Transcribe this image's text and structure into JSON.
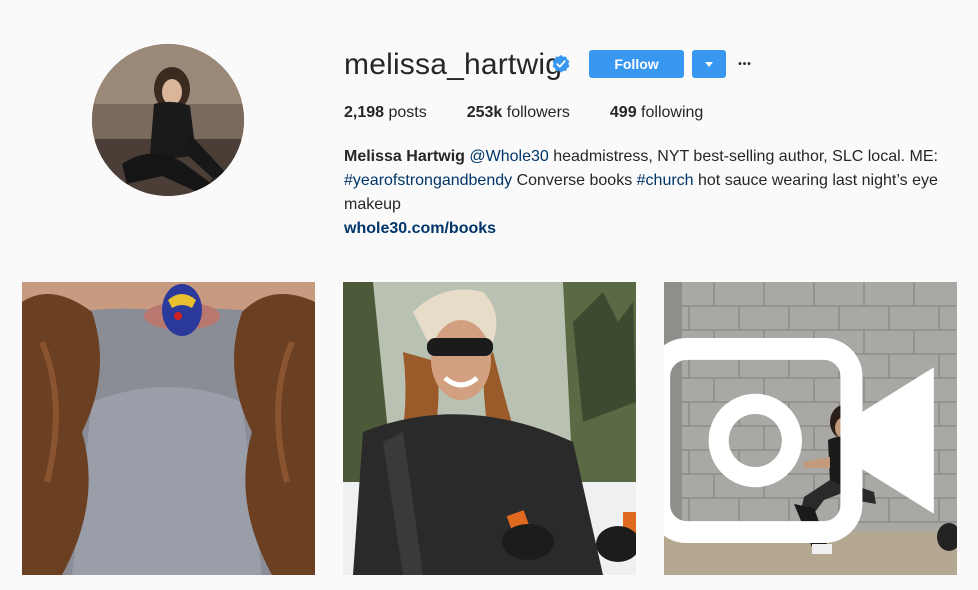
{
  "profile": {
    "username": "melissa_hartwig",
    "verified": true,
    "follow_label": "Follow",
    "more_label": "•••",
    "stats": {
      "posts_count": "2,198",
      "posts_label": " posts",
      "followers_count": "253k",
      "followers_label": " followers",
      "following_count": "499",
      "following_label": " following"
    },
    "bio": {
      "name": "Melissa Hartwig",
      "mention": "@Whole30",
      "text1": " headmistress, NYT best-selling author, SLC local. ME: ",
      "hashtag1": "#yearofstrongandbendy",
      "text2": " Converse books ",
      "hashtag2": "#church",
      "text3": " hot sauce wearing last night’s eye makeup",
      "website": "whole30.com/books"
    }
  },
  "posts": [
    {
      "type": "photo",
      "icon": "none"
    },
    {
      "type": "photo",
      "icon": "none"
    },
    {
      "type": "video",
      "icon": "video-camera-icon"
    }
  ],
  "colors": {
    "accent": "#3897f0",
    "link": "#003569",
    "background": "#fafafa",
    "text": "#262626"
  }
}
